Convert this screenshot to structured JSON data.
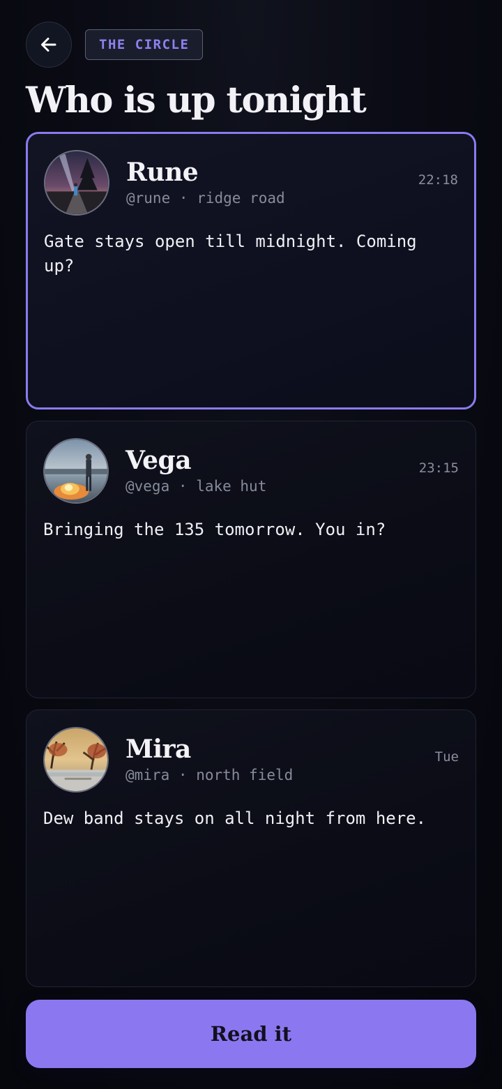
{
  "header": {
    "back_icon": "arrow-left-icon",
    "tag_label": "THE CIRCLE",
    "title": "Who is up tonight"
  },
  "colors": {
    "accent": "#8b78f0",
    "tag_text": "#8c82f0",
    "background": "#080912"
  },
  "messages": [
    {
      "name": "Rune",
      "handle": "@rune",
      "separator": "·",
      "place": "ridge road",
      "time": "22:18",
      "text": "Gate stays open till midnight. Coming up?",
      "selected": true
    },
    {
      "name": "Vega",
      "handle": "@vega",
      "separator": "·",
      "place": "lake hut",
      "time": "23:15",
      "text": "Bringing the 135 tomorrow. You in?",
      "selected": false
    },
    {
      "name": "Mira",
      "handle": "@mira",
      "separator": "·",
      "place": "north field",
      "time": "Tue",
      "text": "Dew band stays on all night from here.",
      "selected": false
    }
  ],
  "action": {
    "label": "Read it"
  }
}
